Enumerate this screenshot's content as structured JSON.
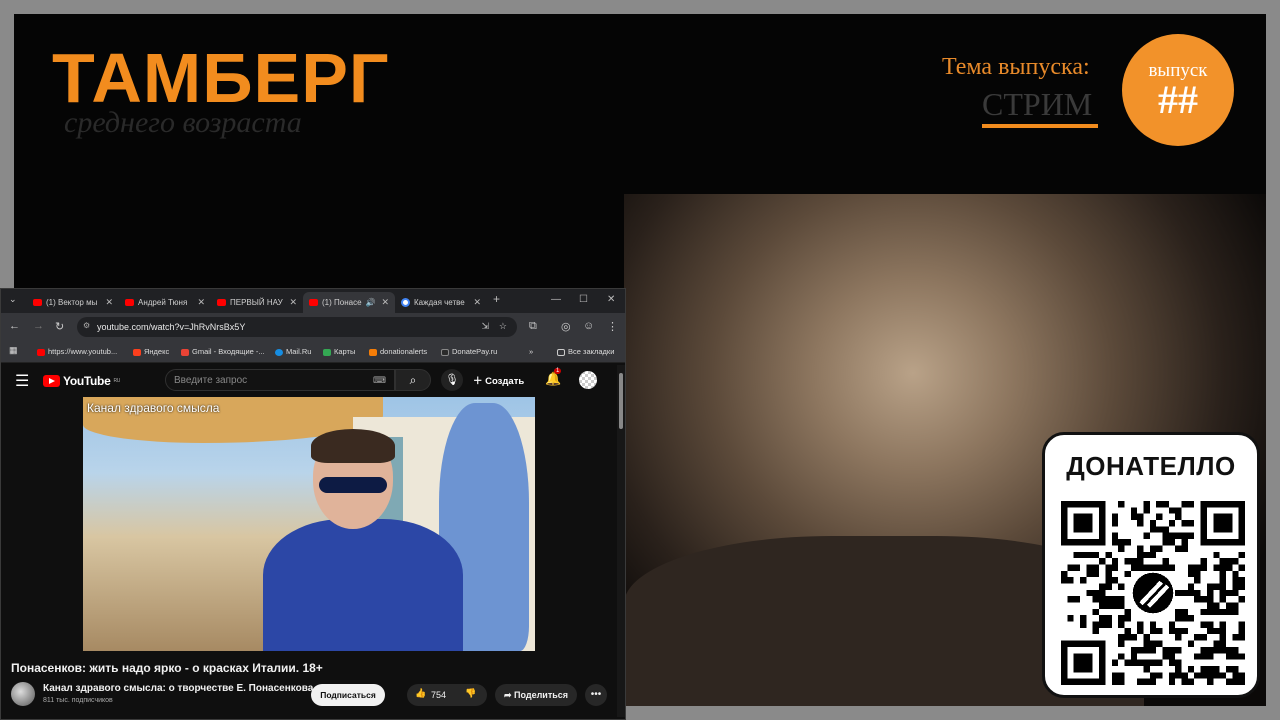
{
  "overlay": {
    "logo_title": "ТАМБЕРГ",
    "logo_subtitle": "среднего возраста",
    "topic_label": "Тема выпуска:",
    "topic_value": "СТРИМ",
    "episode_label": "выпуск",
    "episode_number": "##",
    "accent_color": "#f28c1e"
  },
  "donate": {
    "title": "ДОНАТЕЛЛО"
  },
  "browser": {
    "tabs": [
      {
        "label": "(1) Вектор мы",
        "icon": "youtube-icon"
      },
      {
        "label": "Андрей Тюня",
        "icon": "youtube-icon"
      },
      {
        "label": "ПЕРВЫЙ НАУ",
        "icon": "youtube-icon"
      },
      {
        "label": "(1) Понасе",
        "icon": "youtube-icon",
        "active": true
      },
      {
        "label": "Каждая четве",
        "icon": "google-icon"
      }
    ],
    "url": "youtube.com/watch?v=JhRvNrsBx5Y",
    "bookmarks": [
      "https://www.youtub...",
      "Яндекс",
      "Gmail - Входящие -...",
      "Mail.Ru",
      "Карты",
      "donationalerts",
      "DonatePay.ru"
    ],
    "all_bookmarks": "Все закладки"
  },
  "youtube": {
    "logo": "YouTube",
    "region": "RU",
    "search_placeholder": "Введите запрос",
    "create_label": "Создать",
    "notification_count": "1",
    "video_watermark": "Канал здравого смысла",
    "video_title": "Понасенков: жить надо ярко - о красках Италии. 18+",
    "channel_name": "Канал здравого смысла: о творчестве Е. Понасенкова",
    "subscribers": "811 тыс. подписчиков",
    "subscribe_label": "Подписаться",
    "like_count": "754",
    "share_label": "Поделиться"
  }
}
